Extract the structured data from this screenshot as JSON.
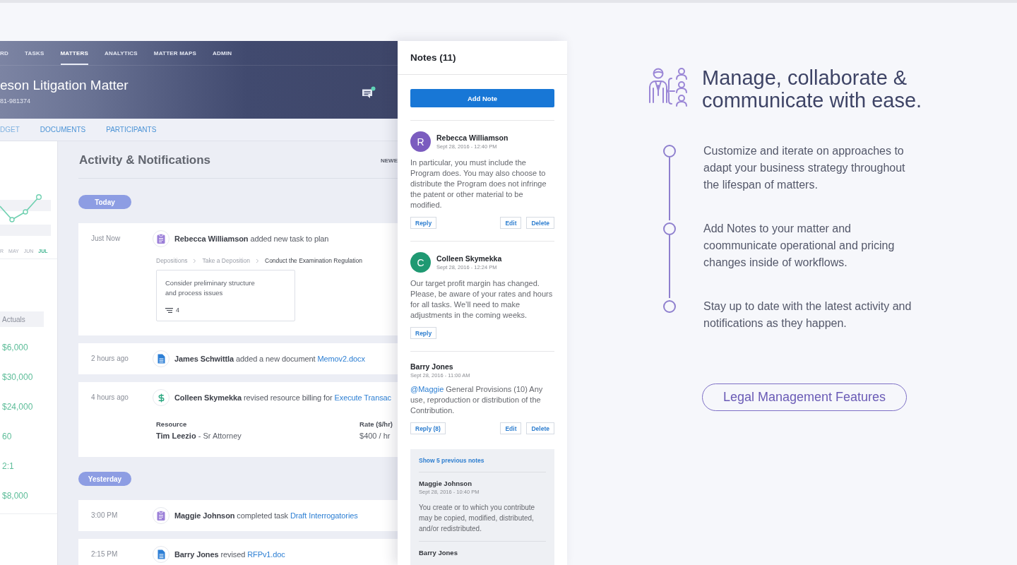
{
  "app": {
    "nav": [
      {
        "label": "RD",
        "selected": false
      },
      {
        "label": "TASKS",
        "selected": false
      },
      {
        "label": "MATTERS",
        "selected": true
      },
      {
        "label": "ANALYTICS",
        "selected": false
      },
      {
        "label": "MATTER MAPS",
        "selected": false
      },
      {
        "label": "ADMIN",
        "selected": false
      }
    ],
    "matter": {
      "title": "eson Litigation Matter",
      "number": "81-981374"
    },
    "subnav": [
      "DGET",
      "DOCUMENTS",
      "PARTICIPANTS"
    ],
    "sidebar": {
      "months": [
        {
          "label": "R",
          "selected": false
        },
        {
          "label": "MAY",
          "selected": false
        },
        {
          "label": "JUN",
          "selected": false
        },
        {
          "label": "JUL",
          "selected": true
        }
      ],
      "actuals_header": "Actuals",
      "actuals": [
        "$6,000",
        "$30,000",
        "$24,000",
        "60",
        "2:1",
        "$8,000"
      ]
    },
    "activity": {
      "title": "Activity & Notifications",
      "sort": "NEWE",
      "groups": [
        {
          "day": "Today",
          "items": [
            {
              "kind": "task",
              "time": "Just Now",
              "actor": "Rebecca Williamson",
              "action": "added new task to plan",
              "breadcrumb": [
                "Depositions",
                "Take a Deposition",
                "Conduct the Examination Regulation"
              ],
              "task": {
                "text": "Consider preliminary structure and process issues",
                "count": "4"
              }
            },
            {
              "kind": "document",
              "time": "2 hours ago",
              "actor": "James Schwittla",
              "action": "added a new document",
              "link": "Memov2.docx"
            },
            {
              "kind": "billing",
              "time": "4 hours ago",
              "actor": "Colleen Skymekka",
              "action": "revised resource billing for",
              "link": "Execute Transac",
              "details": [
                {
                  "label": "Resource",
                  "value": "**Tim Leezio** - Sr Attorney"
                },
                {
                  "label": "Rate ($/hr)",
                  "value": "$400 / hr"
                }
              ]
            }
          ]
        },
        {
          "day": "Yesterday",
          "items": [
            {
              "kind": "task",
              "time": "3:00 PM",
              "actor": "Maggie Johnson",
              "action": "completed task",
              "link": "Draft Interrogatories"
            },
            {
              "kind": "document",
              "time": "2:15 PM",
              "actor": "Barry Jones",
              "action": "revised",
              "link": "RFPv1.doc"
            }
          ]
        }
      ]
    }
  },
  "notes": {
    "title": "Notes (11)",
    "add_button": "Add Note",
    "items": [
      {
        "initial": "R",
        "color": "#7b5cbf",
        "author": "Rebecca Williamson",
        "date": "Sept 28, 2016 - 12:40 PM",
        "body": "In particular, you must include the Program does. You may also choose to distribute the Program does not infringe the patent or other material to be modified.",
        "actions": [
          "Reply",
          "Edit",
          "Delete"
        ]
      },
      {
        "initial": "C",
        "color": "#1f9972",
        "author": "Colleen Skymekka",
        "date": "Sept 28, 2016 - 12:24 PM",
        "body": "Our target profit margin has changed. Please, be aware of your rates and hours for all tasks. We’ll need to make adjustments in the coming weeks.",
        "actions": [
          "Reply"
        ]
      },
      {
        "author": "Barry Jones",
        "date": "Sept 28, 2016 - 11:00 AM",
        "mention": "@Maggie",
        "body": "General Provisions (10) Any use, reproduction or distribution of the Contribution.",
        "actions": [
          "Reply (8)",
          "Edit",
          "Delete"
        ],
        "replies": {
          "show_more": "Show 5 previous notes",
          "items": [
            {
              "author": "Maggie Johnson",
              "date": "Sept 28, 2016 - 10:40 PM",
              "body": "You create or to which you contribute may be copied, modified, distributed, and/or redistributed."
            },
            {
              "author": "Barry Jones"
            }
          ]
        }
      }
    ]
  },
  "feature": {
    "heading": "Manage, collaborate & communicate with ease.",
    "points": [
      "Customize and iterate on approaches to adapt your business strategy throughout the lifespan of matters.",
      "Add Notes to your matter and coommunicate operational and pricing changes inside of workflows.",
      "Stay up to date with the latest activity and notifications as they happen."
    ],
    "button": "Legal Management Features"
  }
}
